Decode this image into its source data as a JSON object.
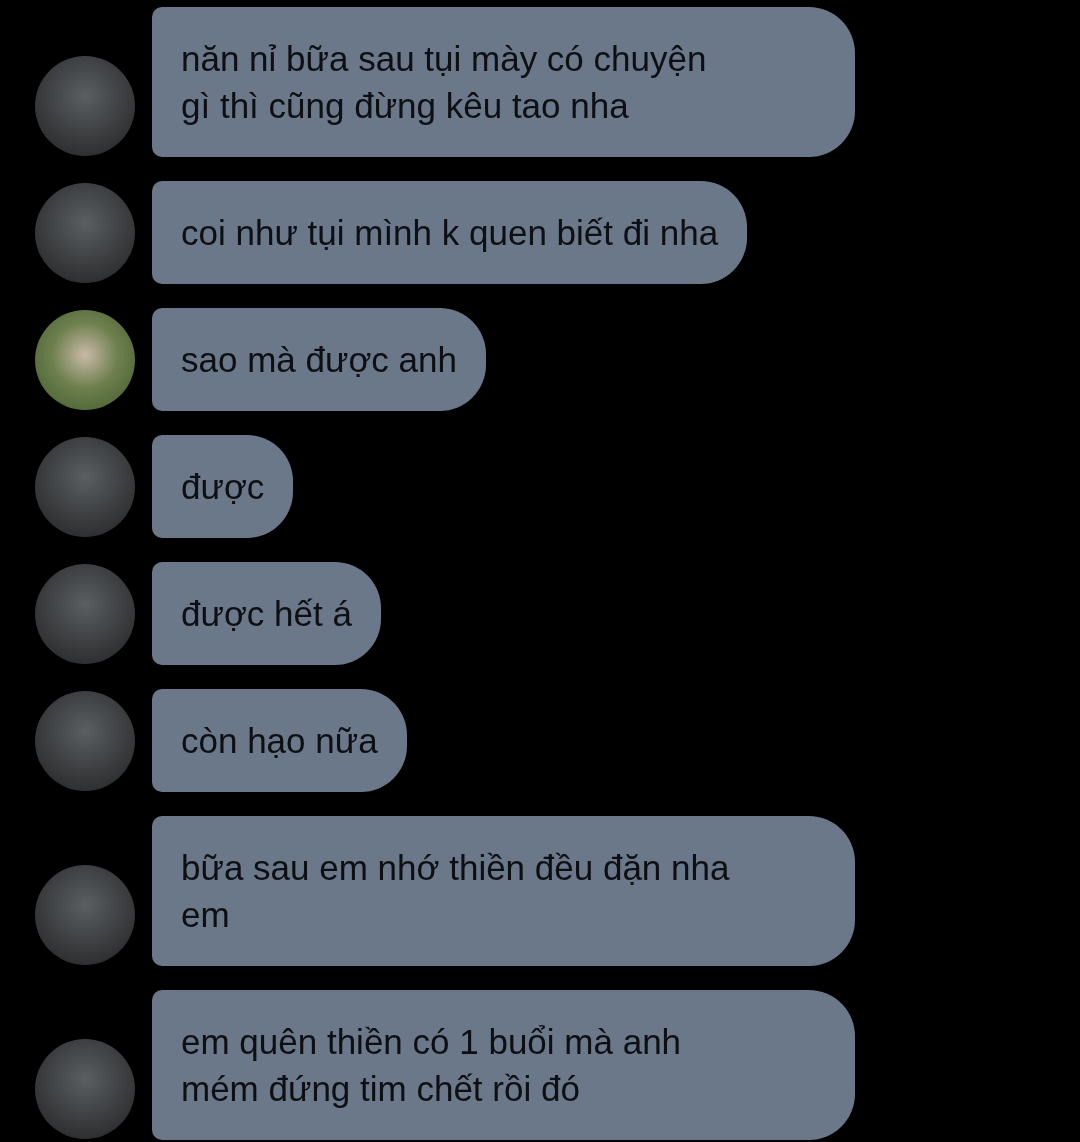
{
  "messages": [
    {
      "kind": "first",
      "lines": [
        "năn nỉ bữa sau tụi mày có chuyện",
        "gì thì cũng đừng kêu tao nha"
      ]
    },
    {
      "kind": "first",
      "lines": [
        "coi như tụi mình k quen biết đi nha"
      ]
    },
    {
      "kind": "second",
      "lines": [
        "sao mà được anh"
      ]
    },
    {
      "kind": "first",
      "lines": [
        "được"
      ]
    },
    {
      "kind": "first",
      "lines": [
        "được hết á"
      ]
    },
    {
      "kind": "first",
      "lines": [
        "còn hạo nữa"
      ]
    },
    {
      "kind": "first",
      "lines": [
        "bữa sau em nhớ thiền đều đặn nha",
        "em"
      ]
    },
    {
      "kind": "first",
      "lines": [
        "em quên thiền có 1 buổi mà anh",
        "mém đứng tim chết rồi đó"
      ]
    }
  ]
}
